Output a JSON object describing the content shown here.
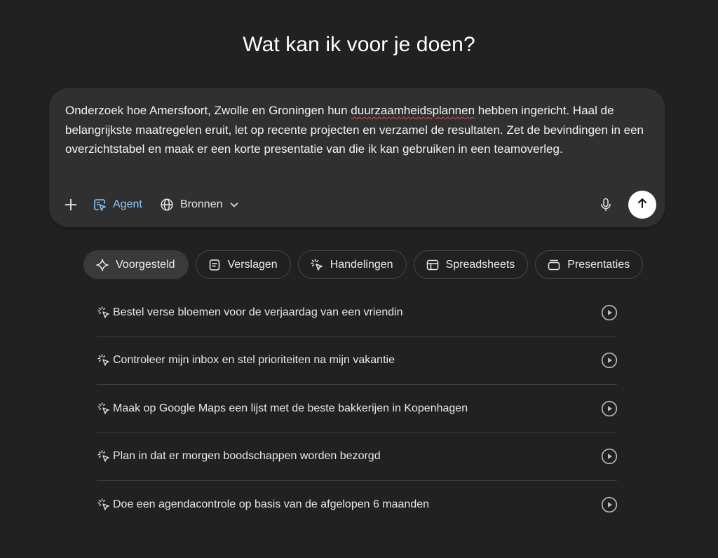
{
  "heading": "Wat kan ik voor je doen?",
  "composer": {
    "text_before": "Onderzoek hoe Amersfoort, Zwolle en Groningen hun ",
    "misspelled_word": "duurzaamheidsplannen",
    "text_after": " hebben ingericht. Haal de belangrijkste maatregelen eruit, let op recente projecten en verzamel de resultaten. Zet de bevindingen in een overzichtstabel en maak er een korte presentatie van die ik kan gebruiken in een teamoverleg.",
    "agent_label": "Agent",
    "sources_label": "Bronnen",
    "icons": {
      "add": "plus-icon",
      "agent": "agent-cursor-icon",
      "sources": "globe-icon",
      "dropdown": "chevron-down-icon",
      "mic": "microphone-icon",
      "send": "arrow-up-icon"
    }
  },
  "chips": [
    {
      "label": "Voorgesteld",
      "icon": "sparkle-icon",
      "active": true
    },
    {
      "label": "Verslagen",
      "icon": "document-icon",
      "active": false
    },
    {
      "label": "Handelingen",
      "icon": "cursor-click-icon",
      "active": false
    },
    {
      "label": "Spreadsheets",
      "icon": "table-icon",
      "active": false
    },
    {
      "label": "Presentaties",
      "icon": "slides-icon",
      "active": false
    }
  ],
  "suggestions": [
    {
      "label": "Bestel verse bloemen voor de verjaardag van een vriendin"
    },
    {
      "label": "Controleer mijn inbox en stel prioriteiten na mijn vakantie"
    },
    {
      "label": "Maak op Google Maps een lijst met de beste bakkerijen in Kopenhagen"
    },
    {
      "label": "Plan in dat er morgen boodschappen worden bezorgd"
    },
    {
      "label": "Doe een agendacontrole op basis van de afgelopen 6 maanden"
    }
  ],
  "colors": {
    "background": "#212121",
    "composer": "#303030",
    "agent_accent": "#8ec5ff",
    "spellcheck": "#e5484d"
  }
}
